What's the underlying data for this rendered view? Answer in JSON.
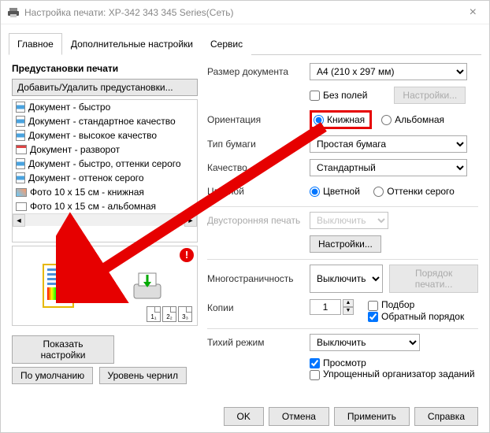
{
  "window": {
    "title": "Настройка печати: XP-342 343 345 Series(Сеть)"
  },
  "tabs": {
    "main": "Главное",
    "advanced": "Дополнительные настройки",
    "service": "Сервис"
  },
  "presets": {
    "title": "Предустановки печати",
    "add_remove": "Добавить/Удалить предустановки...",
    "items": [
      {
        "label": "Документ - быстро"
      },
      {
        "label": "Документ - стандартное качество"
      },
      {
        "label": "Документ - высокое качество"
      },
      {
        "label": "Документ - разворот"
      },
      {
        "label": "Документ - быстро, оттенки серого"
      },
      {
        "label": "Документ - оттенок серого"
      },
      {
        "label": "Фото 10 x 15 см - книжная"
      },
      {
        "label": "Фото 10 x 15 см - альбомная"
      }
    ]
  },
  "left_buttons": {
    "show": "Показать настройки",
    "defaults": "По умолчанию",
    "ink": "Уровень чернил"
  },
  "form": {
    "doc_size_label": "Размер документа",
    "doc_size_value": "A4 (210 x 297 мм)",
    "borderless": "Без полей",
    "settings_btn": "Настройки...",
    "orientation_label": "Ориентация",
    "orientation_portrait": "Книжная",
    "orientation_landscape": "Альбомная",
    "paper_type_label": "Тип бумаги",
    "paper_type_value": "Простая бумага",
    "quality_label": "Качество",
    "quality_value": "Стандартный",
    "color_label": "Цветной",
    "color_color": "Цветной",
    "color_gray": "Оттенки серого",
    "duplex_label": "Двусторонняя печать",
    "duplex_value": "Выключить",
    "duplex_settings": "Настройки...",
    "multipage_label": "Многостраничность",
    "multipage_value": "Выключить",
    "page_order": "Порядок печати...",
    "copies_label": "Копии",
    "copies_value": "1",
    "collate": "Подбор",
    "reverse": "Обратный порядок",
    "quiet_label": "Тихий режим",
    "quiet_value": "Выключить",
    "preview": "Просмотр",
    "simple_org": "Упрощенный организатор заданий"
  },
  "footer": {
    "ok": "OK",
    "cancel": "Отмена",
    "apply": "Применить",
    "help": "Справка"
  },
  "preview_thumbs": [
    "1₁",
    "2₂",
    "3₃"
  ]
}
